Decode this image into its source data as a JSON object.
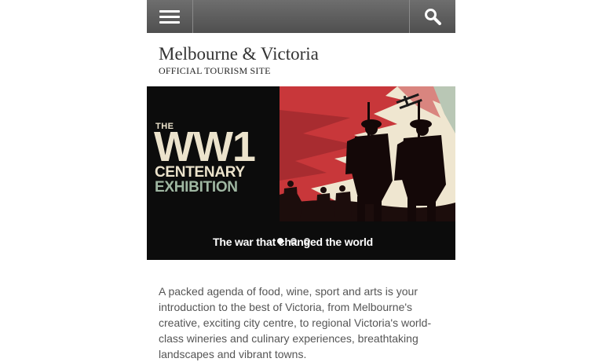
{
  "header": {
    "menu_icon": "hamburger-icon",
    "search_icon": "search-icon",
    "bar_color": "#5e5e5e"
  },
  "site": {
    "title": "Melbourne & Victoria",
    "subtitle": "OFFICIAL TOURISM SITE"
  },
  "banner": {
    "the": "THE",
    "headline": "WW1",
    "line2": "CENTENARY",
    "line3": "EXHIBITION",
    "tagline": "The war that changed the world",
    "slide_count": 3,
    "active_slide": 1,
    "colors": {
      "black": "#0c0c0c",
      "cream": "#ece3cc",
      "red": "#c8373a",
      "sage": "#9fb7a2"
    }
  },
  "intro": {
    "text": "A packed agenda of food, wine, sport and arts is your introduction to the best of Victoria, from Melbourne's creative, exciting city centre, to regional Victoria's world-class wineries and culinary experiences, breathtaking landscapes and vibrant towns."
  }
}
